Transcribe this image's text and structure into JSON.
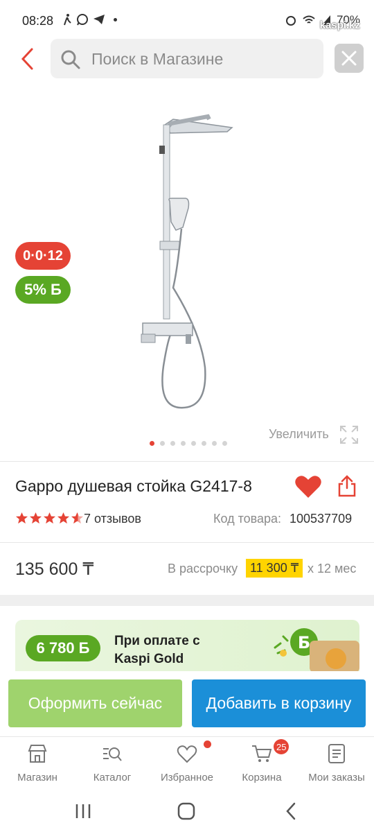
{
  "status_bar": {
    "time": "08:28",
    "battery": "70%",
    "watermark": "kaspi.kz"
  },
  "header": {
    "search_placeholder": "Поиск в Магазине"
  },
  "product": {
    "badge_installment": "0·0·12",
    "badge_bonus": "5% Б",
    "zoom_label": "Увеличить",
    "image_count": 8,
    "active_image": 1,
    "title": "Gappo душевая стойка G2417-8",
    "rating": 4.5,
    "reviews": "7 отзывов",
    "code_label": "Код товара:",
    "code_value": "100537709",
    "price": "135 600 ₸",
    "installment_label": "В рассрочку",
    "installment_amount": "11 300 ₸",
    "installment_term": "х 12 мес"
  },
  "gold_banner": {
    "bonus": "6 780 Б",
    "text_line1": "При оплате с",
    "text_line2": "Kaspi Gold"
  },
  "actions": {
    "buy_now": "Оформить сейчас",
    "add_to_cart": "Добавить в корзину"
  },
  "bottom_nav": {
    "items": [
      {
        "label": "Магазин",
        "icon": "store-icon"
      },
      {
        "label": "Каталог",
        "icon": "catalog-search-icon"
      },
      {
        "label": "Избранное",
        "icon": "heart-outline-icon"
      },
      {
        "label": "Корзина",
        "icon": "cart-icon"
      },
      {
        "label": "Мои заказы",
        "icon": "orders-icon"
      }
    ],
    "cart_count": "25"
  },
  "colors": {
    "accent_red": "#e54335",
    "bonus_green": "#5aa823",
    "buy_button": "#9fd36d",
    "cart_button": "#1b8fd8",
    "highlight_yellow": "#ffd400"
  }
}
